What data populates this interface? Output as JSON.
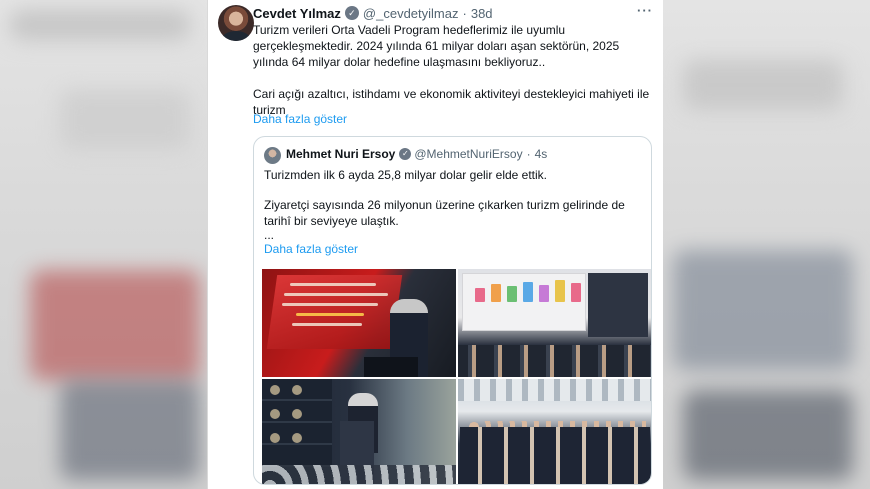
{
  "tweet": {
    "author_name": "Cevdet Yılmaz",
    "handle": "@_cevdetyilmaz",
    "time": "38d",
    "more_icon": "···",
    "verified_icon": "check-badge",
    "body_p1": "Turizm verileri Orta Vadeli Program hedeflerimiz ile uyumlu gerçekleşmektedir. 2024 yılında 61 milyar doları aşan sektörün, 2025 yılında 64 milyar dolar hedefine ulaşmasını bekliyoruz..",
    "body_p2": "Cari açığı azaltıcı, istihdamı ve ekonomik aktiviteyi destekleyici mahiyeti ile turizm",
    "show_more": "Daha fazla göster"
  },
  "quoted_tweet": {
    "author_name": "Mehmet Nuri Ersoy",
    "handle": "@MehmetNuriErsoy",
    "time": "4s",
    "body_p1": "Turizmden ilk 6 ayda 25,8 milyar dolar gelir elde ettik.",
    "body_p2": "Ziyaretçi sayısında 26 milyonun üzerine çıkarken turizm gelirinde de tarihî bir seviyeye ulaştık.",
    "body_p3": "...",
    "show_more": "Daha fazla göster",
    "photo_banner_text": "2025 YILI 6 AYLIK TURİZM VERİLERİ DEĞERLENDİRME VE \"BİR ANADOLU ŞENLİĞİ\" TANITIM TOPLANTISI"
  },
  "colors": {
    "link": "#1d9bf0",
    "text": "#0f1419",
    "muted": "#536471",
    "border": "#cfd9de"
  }
}
